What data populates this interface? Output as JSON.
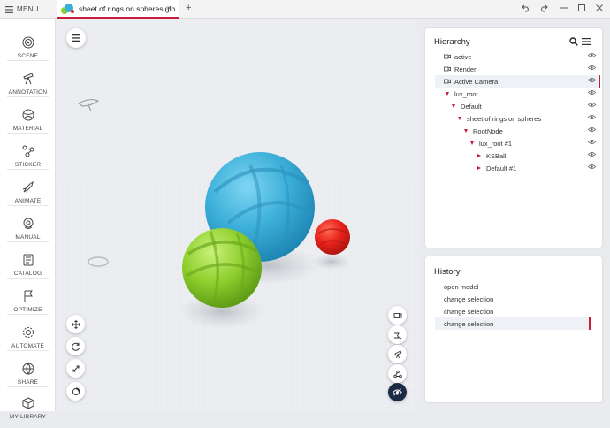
{
  "titlebar": {
    "menu_label": "MENU",
    "tab_title": "sheet of rings on spheres.glb",
    "new_tab": "+",
    "close_tab": "×"
  },
  "sidebar": {
    "items": [
      {
        "label": "SCENE",
        "icon": "scene-icon"
      },
      {
        "label": "ANNOTATION",
        "icon": "annotation-icon"
      },
      {
        "label": "MATERIAL",
        "icon": "material-icon"
      },
      {
        "label": "STICKER",
        "icon": "sticker-icon"
      },
      {
        "label": "ANIMATE",
        "icon": "animate-icon"
      },
      {
        "label": "MANUAL",
        "icon": "manual-icon"
      },
      {
        "label": "CATALOG",
        "icon": "catalog-icon"
      },
      {
        "label": "OPTIMIZE",
        "icon": "optimize-icon"
      },
      {
        "label": "AUTOMATE",
        "icon": "automate-icon"
      },
      {
        "label": "SHARE",
        "icon": "share-icon"
      },
      {
        "label": "MY LIBRARY",
        "icon": "library-icon"
      }
    ]
  },
  "hierarchy": {
    "title": "Hierarchy",
    "rows": [
      {
        "label": "active",
        "type": "camera",
        "depth": 0,
        "selected": false
      },
      {
        "label": "Render",
        "type": "camera",
        "depth": 0,
        "selected": false
      },
      {
        "label": "Active Camera",
        "type": "camera",
        "depth": 0,
        "selected": true
      },
      {
        "label": "lux_root",
        "type": "expanded",
        "depth": 0,
        "selected": false
      },
      {
        "label": "Default",
        "type": "expanded",
        "depth": 1,
        "selected": false
      },
      {
        "label": "sheet of rings on spheres",
        "type": "expanded",
        "depth": 2,
        "selected": false
      },
      {
        "label": "RootNode",
        "type": "expanded",
        "depth": 3,
        "selected": false
      },
      {
        "label": "lux_root #1",
        "type": "expanded",
        "depth": 4,
        "selected": false
      },
      {
        "label": "KSBall",
        "type": "collapsed",
        "depth": 5,
        "selected": false
      },
      {
        "label": "Default #1",
        "type": "collapsed",
        "depth": 5,
        "selected": false
      }
    ]
  },
  "history": {
    "title": "History",
    "items": [
      {
        "label": "open model",
        "selected": false
      },
      {
        "label": "change selection",
        "selected": false
      },
      {
        "label": "change selection",
        "selected": false
      },
      {
        "label": "change selection",
        "selected": true
      }
    ]
  },
  "colors": {
    "accent": "#c41e3a",
    "blue_sphere": "#3aaed8",
    "green_sphere": "#8fcf2e",
    "red_sphere": "#e8221c",
    "toggle_dark": "#1c2b45"
  }
}
